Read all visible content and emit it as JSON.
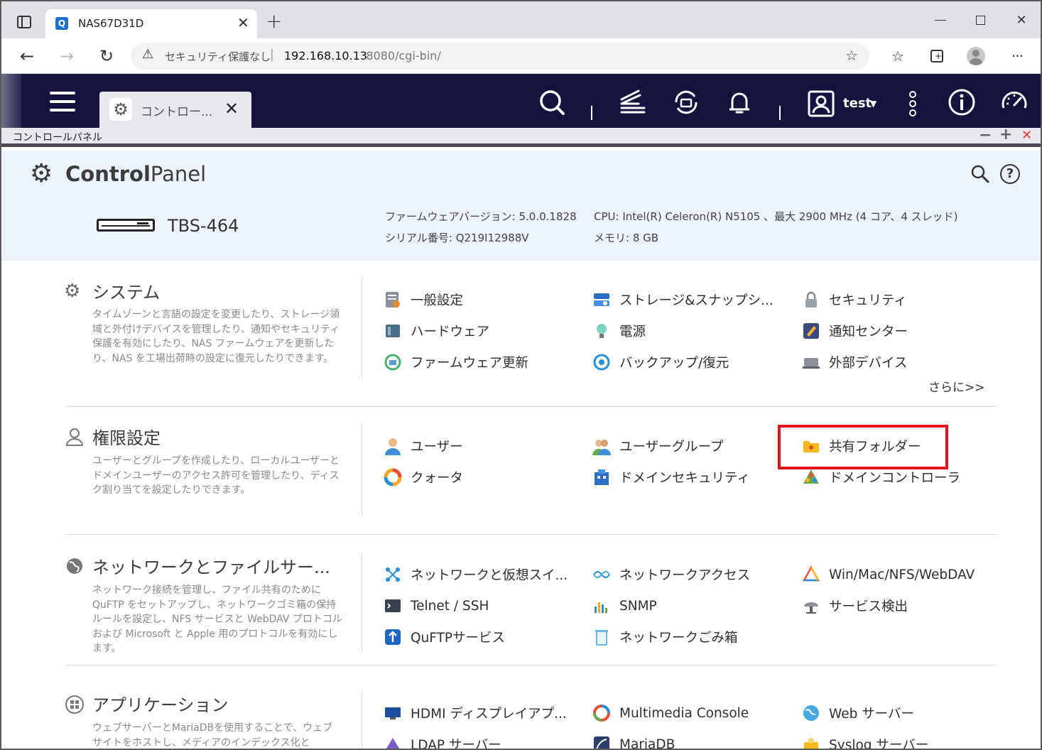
{
  "browser": {
    "tab_title": "NAS67D31D",
    "security_label": "セキュリティ保護なし",
    "url_host": "192.168.10.13",
    "url_rest": ":8080/cgi-bin/"
  },
  "qts": {
    "open_tab_label": "コントロー...",
    "user_name": "test"
  },
  "window": {
    "title": "コントロールパネル"
  },
  "header": {
    "title_bold": "Control",
    "title_light": "Panel",
    "model": "TBS-464",
    "firmware_label": "ファームウェアバージョン:",
    "firmware_value": "5.0.0.1828",
    "serial_label": "シリアル番号:",
    "serial_value": "Q219I12988V",
    "cpu_label": "CPU:",
    "cpu_value": "Intel(R) Celeron(R) N5105 、最大 2900 MHz (4 コア、4 スレッド)",
    "memory_label": "メモリ:",
    "memory_value": "8 GB"
  },
  "sections": [
    {
      "title": "システム",
      "desc": "タイムゾーンと言語の設定を変更したり、ストレージ領域と外付けデバイスを管理したり、通知やセキュリティ保護を有効にしたり、NAS ファームウェアを更新したり、NAS を工場出荷時の設定に復元したりできます。",
      "items": [
        "一般設定",
        "ストレージ&スナップシ...",
        "セキュリティ",
        "ハードウェア",
        "電源",
        "通知センター",
        "ファームウェア更新",
        "バックアップ/復元",
        "外部デバイス"
      ],
      "more": "さらに>>"
    },
    {
      "title": "権限設定",
      "desc": "ユーザーとグループを作成したり、ローカルユーザーとドメインユーザーのアクセス許可を管理したり、ディスク割り当てを設定したりできます。",
      "items": [
        "ユーザー",
        "ユーザーグループ",
        "共有フォルダー",
        "クォータ",
        "ドメインセキュリティ",
        "ドメインコントローラ"
      ]
    },
    {
      "title": "ネットワークとファイルサー...",
      "desc": "ネットワーク接続を管理し、ファイル共有のためにQuFTP をセットアップし、ネットワークゴミ箱の保持ルールを設定し、NFS サービスと WebDAV プロトコルおよび Microsoft と Apple 用のプロトコルを有効にします。",
      "items": [
        "ネットワークと仮想スイ...",
        "ネットワークアクセス",
        "Win/Mac/NFS/WebDAV",
        "Telnet / SSH",
        "SNMP",
        "サービス検出",
        "QuFTPサービス",
        "ネットワークごみ箱"
      ]
    },
    {
      "title": "アプリケーション",
      "desc": "ウェブサーバーとMariaDBを使用することで、ウェブサイトをホストし、メディアのインデックス化と",
      "items": [
        "HDMI ディスプレイアプ...",
        "Multimedia Console",
        "Web サーバー",
        "LDAP サーバー",
        "MariaDB",
        "Syslog サーバー"
      ]
    }
  ]
}
